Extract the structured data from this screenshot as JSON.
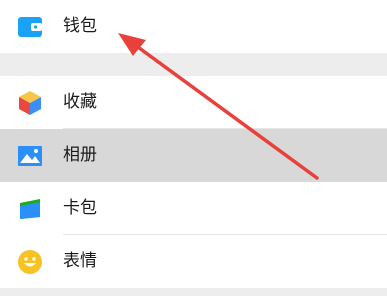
{
  "menu": {
    "items": [
      {
        "id": "wallet",
        "label": "钱包",
        "icon": "wallet-icon",
        "icon_color": "#1aa2f7"
      },
      {
        "id": "favorites",
        "label": "收藏",
        "icon": "cube-icon",
        "icon_color": "#f5b835"
      },
      {
        "id": "album",
        "label": "相册",
        "icon": "image-icon",
        "icon_color": "#2a8ff7"
      },
      {
        "id": "cards",
        "label": "卡包",
        "icon": "card-icon",
        "icon_color": "#1aad19"
      },
      {
        "id": "sticker",
        "label": "表情",
        "icon": "smiley-icon",
        "icon_color": "#f7c224"
      }
    ],
    "selected": "相册"
  },
  "annotation": {
    "arrow_color": "#e8403b",
    "points_to": "钱包"
  }
}
